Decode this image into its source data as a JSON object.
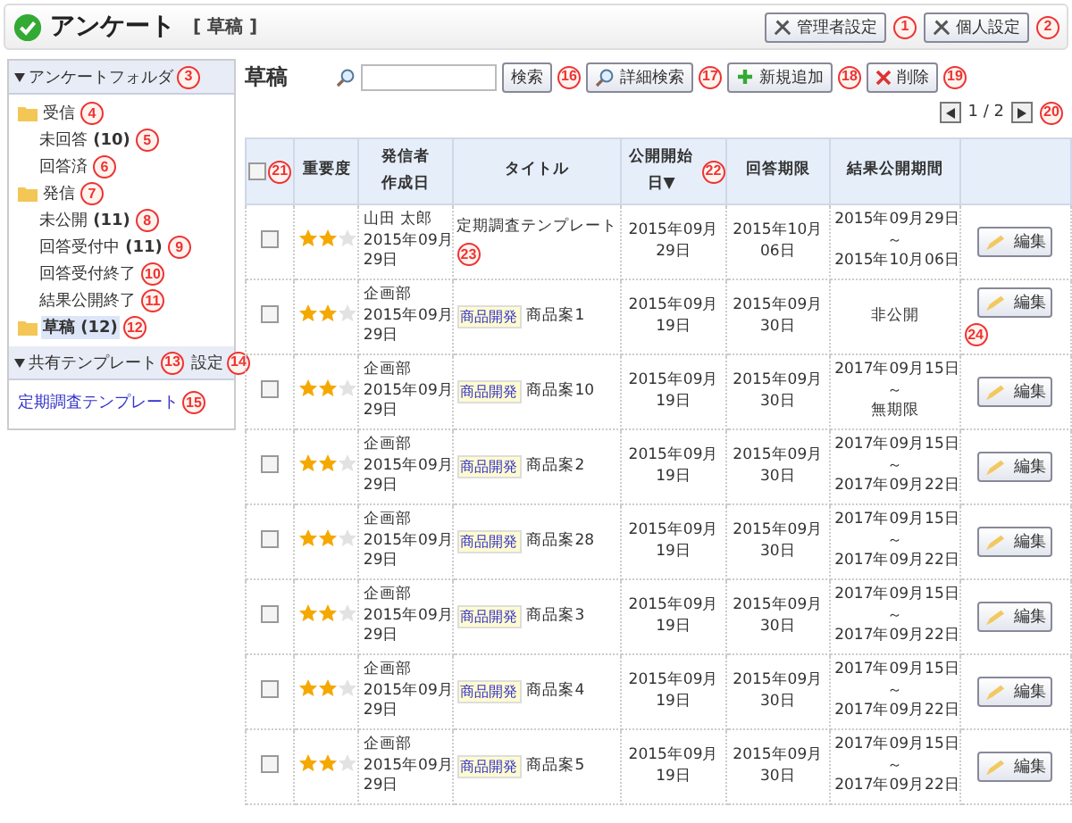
{
  "header": {
    "title": "アンケート",
    "subtitle": "[ 草稿 ]",
    "buttons": [
      {
        "label": "管理者設定",
        "callout": "1"
      },
      {
        "label": "個人設定",
        "callout": "2"
      }
    ]
  },
  "sidebar": {
    "folder_header": "アンケートフォルダ",
    "folder_callout": "3",
    "expanded": true,
    "tree": [
      {
        "label": "受信",
        "callout": "4",
        "selected": false,
        "children": [
          {
            "label": "未回答",
            "count": "(10)",
            "callout": "5",
            "selected": false
          },
          {
            "label": "回答済",
            "callout": "6",
            "selected": false
          }
        ]
      },
      {
        "label": "発信",
        "callout": "7",
        "selected": false,
        "children": [
          {
            "label": "未公開",
            "count": "(11)",
            "callout": "8",
            "selected": false
          },
          {
            "label": "回答受付中",
            "count": "(11)",
            "callout": "9",
            "selected": false
          },
          {
            "label": "回答受付終了",
            "callout": "10",
            "selected": false
          },
          {
            "label": "結果公開終了",
            "callout": "11",
            "selected": false
          }
        ]
      },
      {
        "label": "草稿",
        "count": "(12)",
        "callout": "12",
        "selected": true
      }
    ],
    "template_header": "共有テンプレート",
    "template_callout": "13",
    "template_setting": "設定",
    "setting_callout": "14",
    "templates": [
      {
        "label": "定期調査テンプレート",
        "callout": "15"
      }
    ]
  },
  "main": {
    "title": "草稿",
    "search_button": {
      "label": "検索",
      "callout": "16"
    },
    "buttons": [
      {
        "kind": "search",
        "label": "詳細検索",
        "callout": "17"
      },
      {
        "kind": "add",
        "label": "新規追加",
        "callout": "18"
      },
      {
        "kind": "delete",
        "label": "削除",
        "callout": "19"
      }
    ],
    "pager": "1 / 2",
    "pager_callout": "20",
    "select_all_checked": false,
    "select_all_callout": "21",
    "columns": [
      {
        "lines": [
          "重要度"
        ]
      },
      {
        "lines": [
          "発信者",
          "作成日"
        ]
      },
      {
        "lines": [
          "タイトル"
        ]
      },
      {
        "lines": [
          "公開開始日▼"
        ],
        "callout": "22"
      },
      {
        "lines": [
          "回答期限"
        ]
      },
      {
        "lines": [
          "結果公開期間"
        ]
      }
    ],
    "rows": [
      {
        "checked": false,
        "stars": 2,
        "sender": "山田 太郎",
        "created": [
          "2015年09月",
          "29日"
        ],
        "title": "定期調査テンプレート",
        "title_callout": "23",
        "start": [
          "2015年09月",
          "29日"
        ],
        "deadline": [
          "2015年10月",
          "06日"
        ],
        "period": [
          "2015年09月29日",
          "～",
          "2015年10月06日"
        ],
        "edit_label": "編集"
      },
      {
        "checked": false,
        "stars": 2,
        "sender": "企画部",
        "created": [
          "2015年09月",
          "29日"
        ],
        "tag": "商品開発",
        "title": "商品案1",
        "start": [
          "2015年09月",
          "19日"
        ],
        "deadline": [
          "2015年09月",
          "30日"
        ],
        "period": [
          "非公開"
        ],
        "edit_label": "編集",
        "edit_callout": "24"
      },
      {
        "checked": false,
        "stars": 2,
        "sender": "企画部",
        "created": [
          "2015年09月",
          "29日"
        ],
        "tag": "商品開発",
        "title": "商品案10",
        "start": [
          "2015年09月",
          "19日"
        ],
        "deadline": [
          "2015年09月",
          "30日"
        ],
        "period": [
          "2017年09月15日",
          "～",
          "無期限"
        ],
        "edit_label": "編集"
      },
      {
        "checked": false,
        "stars": 2,
        "sender": "企画部",
        "created": [
          "2015年09月",
          "29日"
        ],
        "tag": "商品開発",
        "title": "商品案2",
        "start": [
          "2015年09月",
          "19日"
        ],
        "deadline": [
          "2015年09月",
          "30日"
        ],
        "period": [
          "2017年09月15日",
          "～",
          "2017年09月22日"
        ],
        "edit_label": "編集"
      },
      {
        "checked": false,
        "stars": 2,
        "sender": "企画部",
        "created": [
          "2015年09月",
          "29日"
        ],
        "tag": "商品開発",
        "title": "商品案28",
        "start": [
          "2015年09月",
          "19日"
        ],
        "deadline": [
          "2015年09月",
          "30日"
        ],
        "period": [
          "2017年09月15日",
          "～",
          "2017年09月22日"
        ],
        "edit_label": "編集"
      },
      {
        "checked": false,
        "stars": 2,
        "sender": "企画部",
        "created": [
          "2015年09月",
          "29日"
        ],
        "tag": "商品開発",
        "title": "商品案3",
        "start": [
          "2015年09月",
          "19日"
        ],
        "deadline": [
          "2015年09月",
          "30日"
        ],
        "period": [
          "2017年09月15日",
          "～",
          "2017年09月22日"
        ],
        "edit_label": "編集"
      },
      {
        "checked": false,
        "stars": 2,
        "sender": "企画部",
        "created": [
          "2015年09月",
          "29日"
        ],
        "tag": "商品開発",
        "title": "商品案4",
        "start": [
          "2015年09月",
          "19日"
        ],
        "deadline": [
          "2015年09月",
          "30日"
        ],
        "period": [
          "2017年09月15日",
          "～",
          "2017年09月22日"
        ],
        "edit_label": "編集"
      },
      {
        "checked": false,
        "stars": 2,
        "sender": "企画部",
        "created": [
          "2015年09月",
          "29日"
        ],
        "tag": "商品開発",
        "title": "商品案5",
        "start": [
          "2015年09月",
          "19日"
        ],
        "deadline": [
          "2015年09月",
          "30日"
        ],
        "period": [
          "2017年09月15日",
          "～",
          "2017年09月22日"
        ],
        "edit_label": "編集"
      }
    ]
  }
}
